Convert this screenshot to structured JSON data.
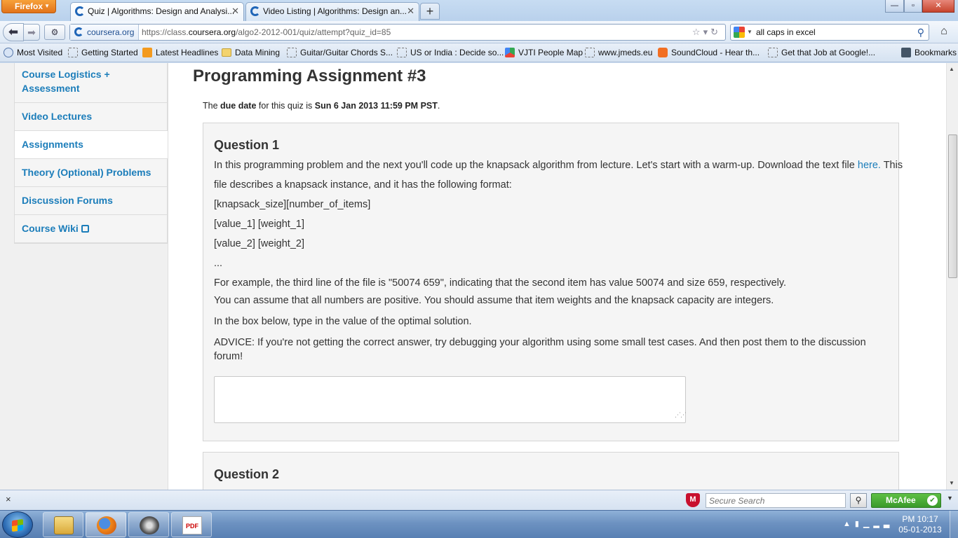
{
  "browser": {
    "menu_button": "Firefox",
    "tabs": [
      {
        "label": "Quiz | Algorithms: Design and Analysi...",
        "active": true
      },
      {
        "label": "Video Listing | Algorithms: Design an...",
        "active": false
      }
    ],
    "window_controls": {
      "minimize": "—",
      "maximize": "▫",
      "close": "✕"
    },
    "identity_label": "coursera.org",
    "url_prefix": "https://class.",
    "url_host": "coursera.org",
    "url_path": "/algo2-2012-001/quiz/attempt?quiz_id=85",
    "search_query": "all caps in excel",
    "bookmarks": [
      {
        "label": "Most Visited",
        "icon": "star"
      },
      {
        "label": "Getting Started",
        "icon": "page"
      },
      {
        "label": "Latest Headlines",
        "icon": "rss"
      },
      {
        "label": "Data Mining",
        "icon": "folder"
      },
      {
        "label": "Guitar/Guitar Chords S...",
        "icon": "page"
      },
      {
        "label": "US or India : Decide so...",
        "icon": "page"
      },
      {
        "label": "VJTI People Map",
        "icon": "map"
      },
      {
        "label": "www.jmeds.eu",
        "icon": "page"
      },
      {
        "label": "SoundCloud - Hear th...",
        "icon": "soundcloud"
      },
      {
        "label": "Get that Job at Google!...",
        "icon": "page"
      }
    ],
    "bookmarks_menu": "Bookmarks"
  },
  "sidebar": {
    "items": [
      {
        "label": "Course Logistics +",
        "label2": "Assessment"
      },
      {
        "label": "Video Lectures"
      },
      {
        "label": "Assignments",
        "selected": true
      },
      {
        "label": "Theory (Optional) Problems"
      },
      {
        "label": "Discussion Forums"
      },
      {
        "label": "Course Wiki",
        "external": true
      }
    ]
  },
  "main": {
    "title": "Programming Assignment #3",
    "due": {
      "pre": "The ",
      "bold1": "due date",
      "mid": " for this quiz is ",
      "bold2": "Sun 6 Jan 2013 11:59 PM PST",
      "post": "."
    },
    "q1": {
      "title": "Question 1",
      "line1_pre": "In this programming problem and the next you'll code up the knapsack algorithm from lecture. Let's start with a warm-up. Download the text file ",
      "line1_link": "here.",
      "line1_post": " This",
      "line2": "file describes a knapsack instance, and it has the following format:",
      "line3": "[knapsack_size][number_of_items]",
      "line4": "[value_1] [weight_1]",
      "line5": "[value_2] [weight_2]",
      "line6": "...",
      "line7": "For example, the third line of the file is \"50074 659\", indicating that the second item has value 50074 and size 659, respectively.",
      "line8": "You can assume that all numbers are positive. You should assume that item weights and the knapsack capacity are integers.",
      "line9": "In the box below, type in the value of the optimal solution.",
      "line10": "ADVICE: If you're not getting the correct answer, try debugging your algorithm using some small test cases. And then post them to the discussion",
      "line11": "forum!",
      "answer_value": ""
    },
    "q2": {
      "title": "Question 2"
    }
  },
  "addon_bar": {
    "close": "×",
    "secure_search_placeholder": "Secure Search",
    "mcafee_label": "McAfee"
  },
  "taskbar": {
    "clock_time": "PM 10:17",
    "clock_date": "05-01-2013",
    "pdf_label": "PDF"
  }
}
